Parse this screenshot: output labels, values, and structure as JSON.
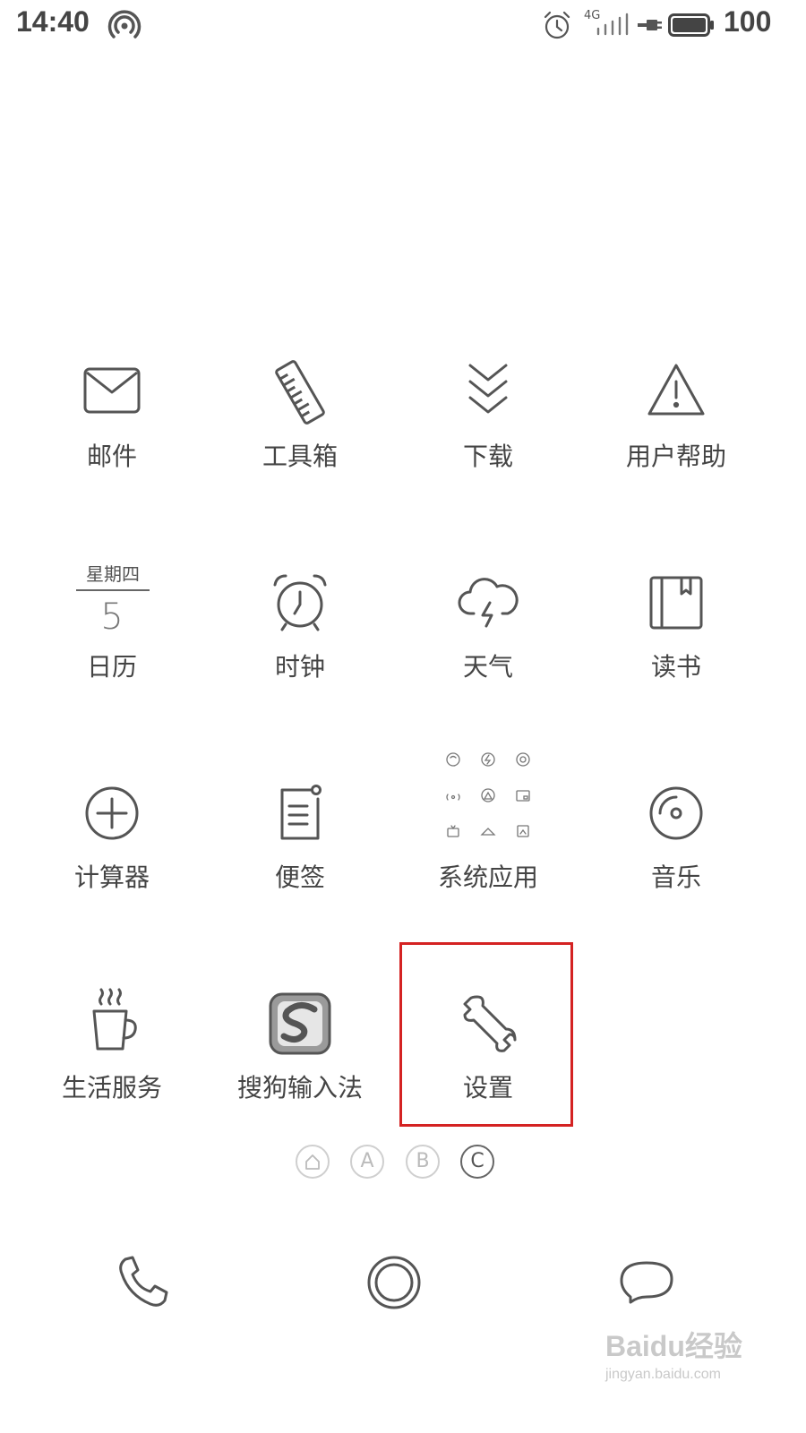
{
  "status_bar": {
    "time": "14:40",
    "network_type": "4G",
    "battery_level": "100"
  },
  "apps": [
    {
      "label": "邮件",
      "icon": "mail-icon"
    },
    {
      "label": "工具箱",
      "icon": "ruler-icon"
    },
    {
      "label": "下载",
      "icon": "download-icon"
    },
    {
      "label": "用户帮助",
      "icon": "warning-icon"
    },
    {
      "label": "日历",
      "icon": "calendar-icon",
      "weekday": "星期四",
      "day": "5"
    },
    {
      "label": "时钟",
      "icon": "alarm-clock-icon"
    },
    {
      "label": "天气",
      "icon": "cloud-lightning-icon"
    },
    {
      "label": "读书",
      "icon": "book-icon"
    },
    {
      "label": "计算器",
      "icon": "plus-circle-icon"
    },
    {
      "label": "便签",
      "icon": "note-icon"
    },
    {
      "label": "系统应用",
      "icon": "app-folder-icon"
    },
    {
      "label": "音乐",
      "icon": "disc-icon"
    },
    {
      "label": "生活服务",
      "icon": "coffee-cup-icon"
    },
    {
      "label": "搜狗输入法",
      "icon": "sogou-logo-icon"
    },
    {
      "label": "设置",
      "icon": "wrench-icon",
      "highlighted": true
    }
  ],
  "page_indicators": [
    {
      "label": "",
      "icon": "home-icon"
    },
    {
      "label": "A"
    },
    {
      "label": "B"
    },
    {
      "label": "C",
      "active": true
    }
  ],
  "dock": [
    {
      "icon": "phone-icon"
    },
    {
      "icon": "home-button-icon"
    },
    {
      "icon": "message-icon"
    }
  ],
  "watermark": {
    "brand": "Baidu经验",
    "url": "jingyan.baidu.com"
  },
  "colors": {
    "highlight": "#d42222",
    "icon_stroke": "#555555",
    "text": "#444444"
  }
}
